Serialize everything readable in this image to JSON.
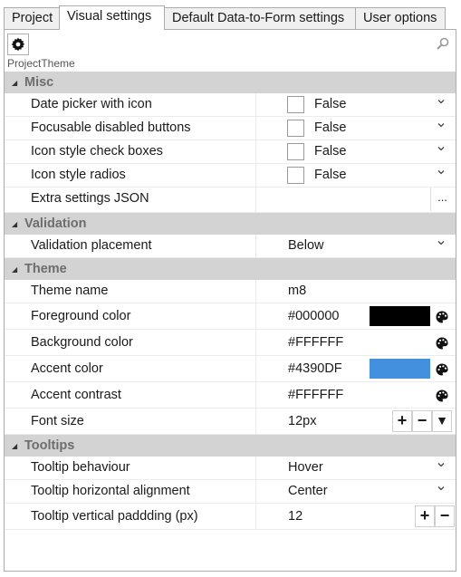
{
  "tabs": [
    {
      "label": "Project"
    },
    {
      "label": "Visual settings"
    },
    {
      "label": "Default Data-to-Form settings"
    },
    {
      "label": "User options"
    }
  ],
  "active_tab": "Visual settings",
  "toolbar": {
    "settings_icon": "gear-icon",
    "search_icon": "search-icon"
  },
  "object_name": "ProjectTheme",
  "sections": {
    "misc": {
      "title": "Misc",
      "date_picker": {
        "name": "Date picker with icon",
        "value": "False"
      },
      "focusable_disabled": {
        "name": "Focusable disabled buttons",
        "value": "False"
      },
      "icon_check": {
        "name": "Icon style check boxes",
        "value": "False"
      },
      "icon_radios": {
        "name": "Icon style radios",
        "value": "False"
      },
      "extra_json": {
        "name": "Extra settings JSON",
        "button": "..."
      }
    },
    "validation": {
      "title": "Validation",
      "placement": {
        "name": "Validation placement",
        "value": "Below"
      }
    },
    "theme": {
      "title": "Theme",
      "theme_name": {
        "name": "Theme name",
        "value": "m8"
      },
      "foreground": {
        "name": "Foreground color",
        "value": "#000000"
      },
      "background": {
        "name": "Background color",
        "value": "#FFFFFF"
      },
      "accent": {
        "name": "Accent color",
        "value": "#4390DF"
      },
      "accent_contrast": {
        "name": "Accent contrast",
        "value": "#FFFFFF"
      },
      "font_size": {
        "name": "Font size",
        "value": "12px"
      }
    },
    "tooltips": {
      "title": "Tooltips",
      "behaviour": {
        "name": "Tooltip behaviour",
        "value": "Hover"
      },
      "h_align": {
        "name": "Tooltip horizontal alignment",
        "value": "Center"
      },
      "v_padding": {
        "name": "Tooltip vertical paddding (px)",
        "value": "12"
      }
    }
  },
  "stepper_labels": {
    "plus": "+",
    "minus": "−",
    "dropdown": "▼"
  },
  "colors": {
    "category_bg": "#d3d3d3",
    "foreground_swatch": "#000000",
    "accent_swatch": "#4390DF"
  }
}
